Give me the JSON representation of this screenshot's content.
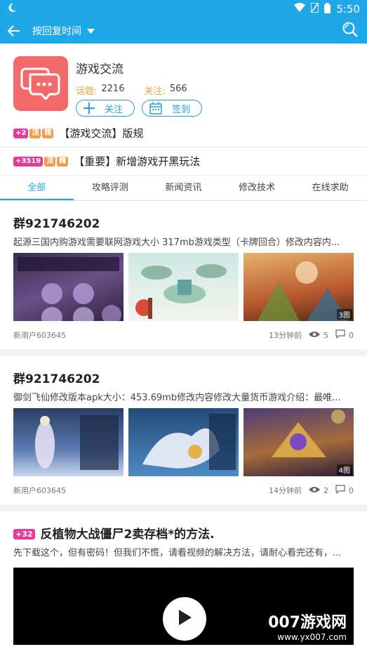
{
  "status": {
    "time": "5:50"
  },
  "toolbar": {
    "sort_label": "按回复时间"
  },
  "forum": {
    "title": "游戏交流",
    "topics_label": "话题:",
    "topics_value": "2216",
    "follow_label": "关注:",
    "follow_value": "566",
    "follow_button": "关注",
    "signin_button": "签到"
  },
  "pinned": [
    {
      "badge_num": "+2",
      "badge_tag1": "顶",
      "badge_tag2": "精",
      "text": "【游戏交流】版规"
    },
    {
      "badge_num": "+3519",
      "badge_tag1": "顶",
      "badge_tag2": "精",
      "text": "【重要】新增游戏开黑玩法"
    }
  ],
  "tabs": [
    "全部",
    "攻略评测",
    "新闻资讯",
    "修改技术",
    "在线求助"
  ],
  "posts": [
    {
      "title": "群921746202",
      "summary": "起源三国内购游戏需要联网游戏大小 317mb游戏类型（卡牌回合）修改内容内...",
      "image_count": "3图",
      "author": "新用户603645",
      "time": "13分钟前",
      "views": "5",
      "comments": "0"
    },
    {
      "title": "群921746202",
      "summary": "御剑飞仙修改版本apk大小：453.69mb修改内容修改大量货币游戏介绍：最唯...",
      "image_count": "4图",
      "author": "新用户603645",
      "time": "14分钟前",
      "views": "2",
      "comments": "0"
    },
    {
      "badge": "+32",
      "title": "反植物大战僵尸2卖存档*的方法.",
      "summary": "先下载这个，但有密码！但我们不慌，请看视频的解决方法，请耐心看完还有，..."
    }
  ],
  "watermark": {
    "big": "007游戏网",
    "small": "www.yx007.com"
  },
  "colors": {
    "primary": "#1fa8e8",
    "accent_orange": "#f0a23a",
    "badge_pink": "#e8399b",
    "icon_red": "#f46a6a"
  }
}
